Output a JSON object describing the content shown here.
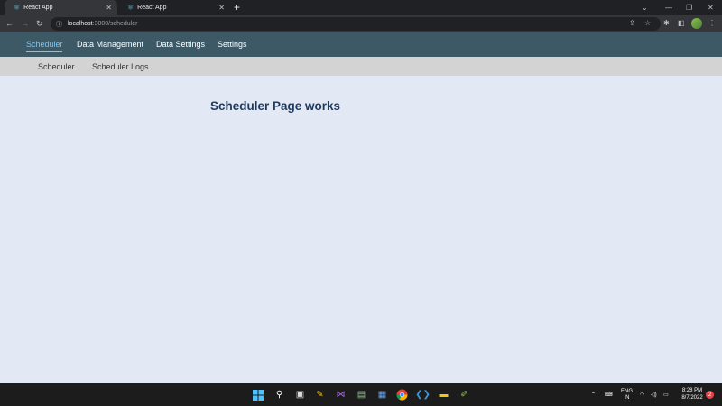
{
  "browser": {
    "tabs": [
      {
        "title": "React App",
        "active": true
      },
      {
        "title": "React App",
        "active": false
      }
    ],
    "new_tab": "+",
    "url_host": "localhost",
    "url_path": ":3000/scheduler"
  },
  "app": {
    "nav": [
      {
        "label": "Scheduler",
        "active": true
      },
      {
        "label": "Data Management",
        "active": false
      },
      {
        "label": "Data Settings",
        "active": false
      },
      {
        "label": "Settings",
        "active": false
      }
    ],
    "subnav": [
      {
        "label": "Scheduler"
      },
      {
        "label": "Scheduler Logs"
      }
    ],
    "heading": "Scheduler Page works"
  },
  "taskbar": {
    "language": "ENG",
    "region": "IN",
    "time": "8:28 PM",
    "date": "8/7/2022",
    "notification_count": "2"
  },
  "colors": {
    "app_nav_bg": "#3d5966",
    "nav_active": "#7fc4ef",
    "subnav_bg": "#d3d3d3",
    "content_bg": "#e2e8f4",
    "heading": "#1f3a5f"
  },
  "icons": [
    "react-favicon-icon",
    "close-icon",
    "plus-icon",
    "back-arrow-icon",
    "forward-arrow-icon",
    "reload-icon",
    "info-icon",
    "share-icon",
    "star-icon",
    "extensions-icon",
    "sidepanel-icon",
    "windows-start-icon",
    "search-icon",
    "task-view-icon",
    "chrome-icon",
    "vscode-icon",
    "file-explorer-icon",
    "wifi-icon",
    "volume-icon",
    "battery-icon"
  ]
}
